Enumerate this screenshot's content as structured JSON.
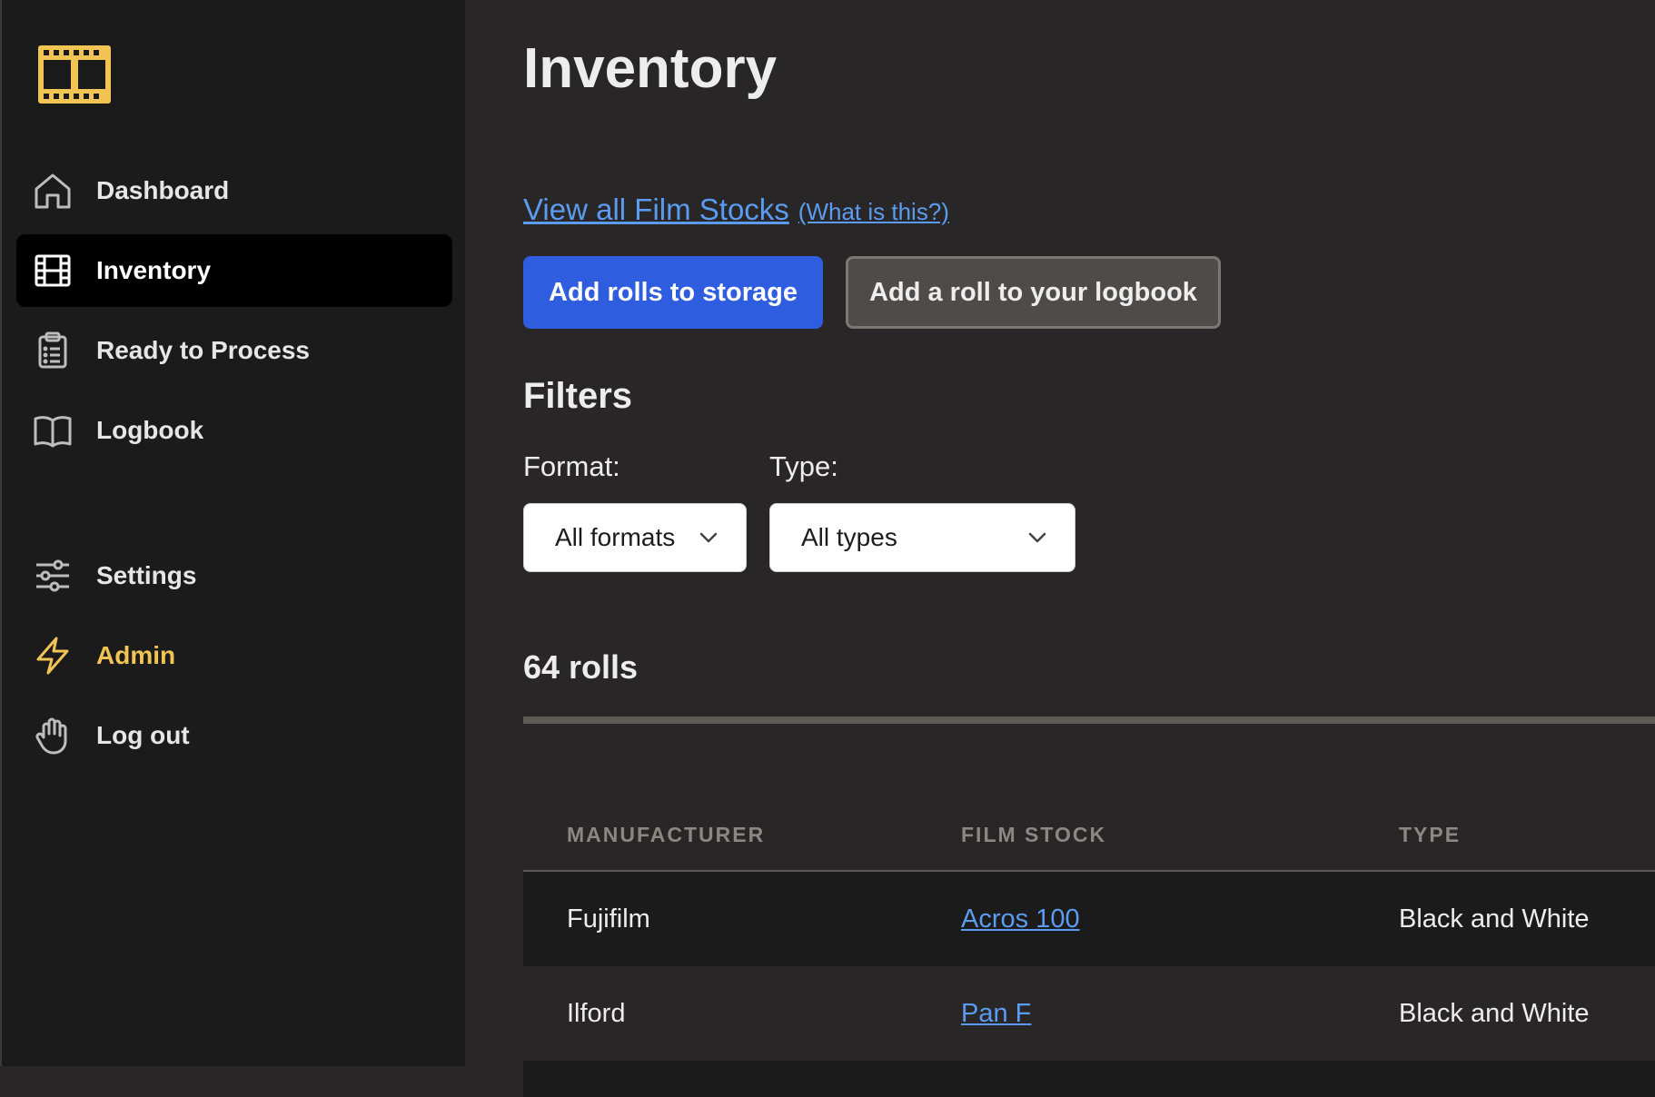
{
  "sidebar": {
    "nav": [
      {
        "label": "Dashboard",
        "icon": "home-icon"
      },
      {
        "label": "Inventory",
        "icon": "film-icon",
        "active": true
      },
      {
        "label": "Ready to Process",
        "icon": "clipboard-icon"
      },
      {
        "label": "Logbook",
        "icon": "book-icon"
      }
    ],
    "secondary": [
      {
        "label": "Settings",
        "icon": "sliders-icon"
      },
      {
        "label": "Admin",
        "icon": "bolt-icon"
      },
      {
        "label": "Log out",
        "icon": "hand-icon"
      }
    ]
  },
  "main": {
    "title": "Inventory",
    "view_all_link": "View all Film Stocks",
    "what_is_this_link": "(What is this?)",
    "buttons": {
      "add_storage": "Add rolls to storage",
      "add_logbook": "Add a roll to your logbook"
    },
    "filters": {
      "title": "Filters",
      "format_label": "Format:",
      "format_value": "All formats",
      "type_label": "Type:",
      "type_value": "All types"
    },
    "count": "64 rolls",
    "table": {
      "headers": [
        "MANUFACTURER",
        "FILM STOCK",
        "TYPE"
      ],
      "rows": [
        {
          "manufacturer": "Fujifilm",
          "film_stock": "Acros 100",
          "type": "Black and White"
        },
        {
          "manufacturer": "Ilford",
          "film_stock": "Pan F",
          "type": "Black and White"
        }
      ]
    }
  },
  "colors": {
    "accent_blue": "#2f5de0",
    "link_blue": "#5b9cf0",
    "admin_yellow": "#f1c453",
    "sidebar_bg": "#1b1b1b",
    "main_bg": "#282626"
  }
}
